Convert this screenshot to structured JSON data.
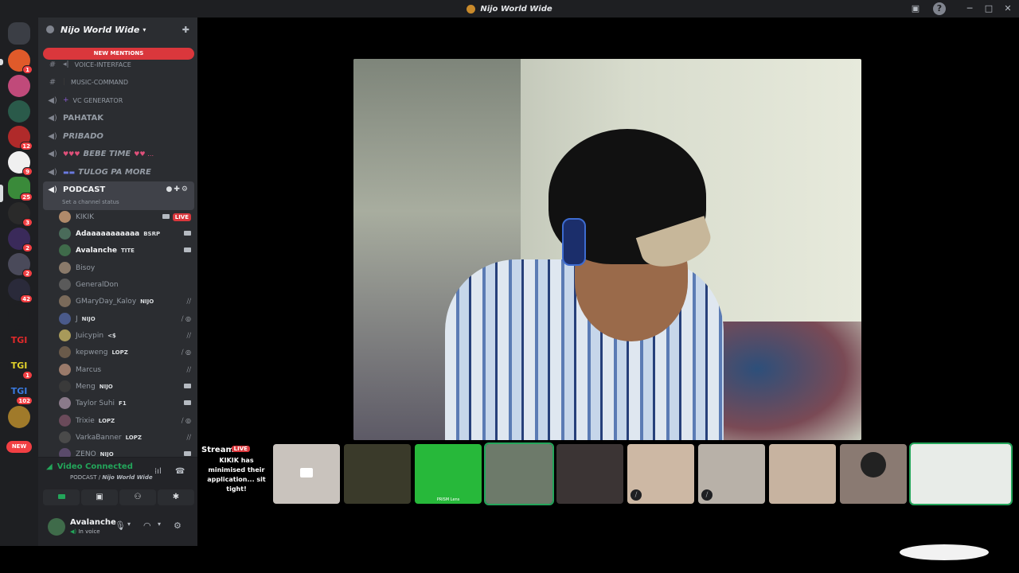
{
  "window": {
    "title": "Nijo World Wide"
  },
  "guilds": {
    "badges": [
      "1",
      "12",
      "9",
      "25",
      "3",
      "2",
      "2",
      "42",
      "1",
      "102"
    ],
    "new_label": "NEW"
  },
  "server": {
    "name": "Nijo World Wide",
    "new_mentions": "NEW MENTIONS",
    "channels": [
      {
        "name": "VOICE-INTERFACE",
        "type": "text"
      },
      {
        "name": "MUSIC-COMMAND",
        "type": "text"
      },
      {
        "name": "VC GENERATOR",
        "type": "voice"
      },
      {
        "name": "PAHATAK",
        "type": "voice"
      },
      {
        "name": "PRIBADO",
        "type": "voice"
      },
      {
        "name": "BEBE TIME",
        "type": "voice"
      },
      {
        "name": "TULOG PA MORE",
        "type": "voice"
      },
      {
        "name": "PODCAST",
        "type": "voice",
        "status": "Set a channel status"
      }
    ],
    "voice_users": [
      {
        "name": "KIKIK",
        "live": "LIVE",
        "color": "#b08a6a"
      },
      {
        "name": "Adaaaaaaaaaaa",
        "tag": "BSRP",
        "color": "#4a6b5a",
        "bright": true
      },
      {
        "name": "Avalanche",
        "tag": "TITE",
        "color": "#3f6b4a",
        "bright": true
      },
      {
        "name": "Bisoy",
        "color": "#8a7a6a"
      },
      {
        "name": "GeneralDon",
        "color": "#5a5a5a"
      },
      {
        "name": "GMaryDay_Kaloy",
        "tag": "NIJO",
        "color": "#7a6a5a"
      },
      {
        "name": "J",
        "tag": "NIJO",
        "color": "#4a5a8a"
      },
      {
        "name": "Juicypin",
        "tag": "<$",
        "color": "#a89a5a"
      },
      {
        "name": "kepweng",
        "tag": "LOPZ",
        "color": "#6a5a4a"
      },
      {
        "name": "Marcus",
        "color": "#9a7a6a"
      },
      {
        "name": "Meng",
        "tag": "NIJO",
        "color": "#3a3a3a"
      },
      {
        "name": "Taylor Suhi",
        "tag": "F1",
        "color": "#8a7a8a"
      },
      {
        "name": "Trixie",
        "tag": "LOPZ",
        "color": "#6a4a5a"
      },
      {
        "name": "VarkaBanner",
        "tag": "LOPZ",
        "color": "#4a4a4a"
      },
      {
        "name": "ZENO",
        "tag": "NIJO",
        "color": "#5a4a6a"
      }
    ]
  },
  "voice_panel": {
    "status": "Video Connected",
    "channel": "PODCAST",
    "server": "Nijo World Wide"
  },
  "user_panel": {
    "name": "Avalanche",
    "status": "In voice"
  },
  "stream": {
    "title": "Stream Pa",
    "live": "LIVE",
    "message": "KIKIK has minimised their application... sit tight!"
  },
  "thumbnails": [
    {
      "color": "#c9c3bd"
    },
    {
      "color": "#3a3a2a"
    },
    {
      "color": "#27b83a",
      "label": "PRISM Lens"
    },
    {
      "color": "#6d7a6a",
      "selected": true
    },
    {
      "color": "#3b3434"
    },
    {
      "color": "#cdb8a4"
    },
    {
      "color": "#b8b1a8"
    },
    {
      "color": "#c7b3a0"
    },
    {
      "color": "#8a7a72"
    },
    {
      "color": "#e8ece8",
      "selected": true
    }
  ]
}
